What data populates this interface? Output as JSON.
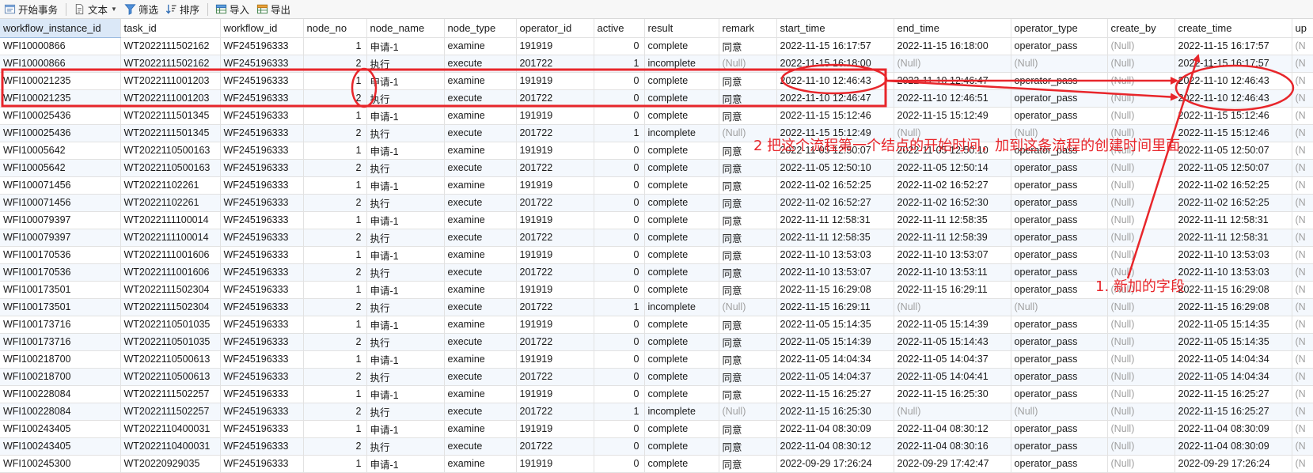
{
  "toolbar": {
    "begin_tx": "开始事务",
    "text": "文本",
    "filter": "筛选",
    "sort": "排序",
    "import": "导入",
    "export": "导出"
  },
  "columns": [
    "workflow_instance_id",
    "task_id",
    "workflow_id",
    "node_no",
    "node_name",
    "node_type",
    "operator_id",
    "active",
    "result",
    "remark",
    "start_time",
    "end_time",
    "operator_type",
    "create_by",
    "create_time",
    "up"
  ],
  "rows": [
    [
      "WFI10000866",
      "WT2022111502162",
      "WF245196333",
      "1",
      "申请-1",
      "examine",
      "191919",
      "0",
      "complete",
      "同意",
      "2022-11-15 16:17:57",
      "2022-11-15 16:18:00",
      "operator_pass",
      "(Null)",
      "2022-11-15 16:17:57",
      "(N"
    ],
    [
      "WFI10000866",
      "WT2022111502162",
      "WF245196333",
      "2",
      "执行",
      "execute",
      "201722",
      "1",
      "incomplete",
      "(Null)",
      "2022-11-15 16:18:00",
      "(Null)",
      "(Null)",
      "(Null)",
      "2022-11-15 16:17:57",
      "(N"
    ],
    [
      "WFI100021235",
      "WT2022111001203",
      "WF245196333",
      "1",
      "申请-1",
      "examine",
      "191919",
      "0",
      "complete",
      "同意",
      "2022-11-10 12:46:43",
      "2022-11-10 12:46:47",
      "operator_pass",
      "(Null)",
      "2022-11-10 12:46:43",
      "(N"
    ],
    [
      "WFI100021235",
      "WT2022111001203",
      "WF245196333",
      "2",
      "执行",
      "execute",
      "201722",
      "0",
      "complete",
      "同意",
      "2022-11-10 12:46:47",
      "2022-11-10 12:46:51",
      "operator_pass",
      "(Null)",
      "2022-11-10 12:46:43",
      "(N"
    ],
    [
      "WFI100025436",
      "WT2022111501345",
      "WF245196333",
      "1",
      "申请-1",
      "examine",
      "191919",
      "0",
      "complete",
      "同意",
      "2022-11-15 15:12:46",
      "2022-11-15 15:12:49",
      "operator_pass",
      "(Null)",
      "2022-11-15 15:12:46",
      "(N"
    ],
    [
      "WFI100025436",
      "WT2022111501345",
      "WF245196333",
      "2",
      "执行",
      "execute",
      "201722",
      "1",
      "incomplete",
      "(Null)",
      "2022-11-15 15:12:49",
      "(Null)",
      "(Null)",
      "(Null)",
      "2022-11-15 15:12:46",
      "(N"
    ],
    [
      "WFI10005642",
      "WT2022110500163",
      "WF245196333",
      "1",
      "申请-1",
      "examine",
      "191919",
      "0",
      "complete",
      "同意",
      "2022-11-05 12:50:07",
      "2022-11-05 12:50:10",
      "operator_pass",
      "(Null)",
      "2022-11-05 12:50:07",
      "(N"
    ],
    [
      "WFI10005642",
      "WT2022110500163",
      "WF245196333",
      "2",
      "执行",
      "execute",
      "201722",
      "0",
      "complete",
      "同意",
      "2022-11-05 12:50:10",
      "2022-11-05 12:50:14",
      "operator_pass",
      "(Null)",
      "2022-11-05 12:50:07",
      "(N"
    ],
    [
      "WFI100071456",
      "WT20221102261",
      "WF245196333",
      "1",
      "申请-1",
      "examine",
      "191919",
      "0",
      "complete",
      "同意",
      "2022-11-02 16:52:25",
      "2022-11-02 16:52:27",
      "operator_pass",
      "(Null)",
      "2022-11-02 16:52:25",
      "(N"
    ],
    [
      "WFI100071456",
      "WT20221102261",
      "WF245196333",
      "2",
      "执行",
      "execute",
      "201722",
      "0",
      "complete",
      "同意",
      "2022-11-02 16:52:27",
      "2022-11-02 16:52:30",
      "operator_pass",
      "(Null)",
      "2022-11-02 16:52:25",
      "(N"
    ],
    [
      "WFI100079397",
      "WT2022111100014",
      "WF245196333",
      "1",
      "申请-1",
      "examine",
      "191919",
      "0",
      "complete",
      "同意",
      "2022-11-11 12:58:31",
      "2022-11-11 12:58:35",
      "operator_pass",
      "(Null)",
      "2022-11-11 12:58:31",
      "(N"
    ],
    [
      "WFI100079397",
      "WT2022111100014",
      "WF245196333",
      "2",
      "执行",
      "execute",
      "201722",
      "0",
      "complete",
      "同意",
      "2022-11-11 12:58:35",
      "2022-11-11 12:58:39",
      "operator_pass",
      "(Null)",
      "2022-11-11 12:58:31",
      "(N"
    ],
    [
      "WFI100170536",
      "WT2022111001606",
      "WF245196333",
      "1",
      "申请-1",
      "examine",
      "191919",
      "0",
      "complete",
      "同意",
      "2022-11-10 13:53:03",
      "2022-11-10 13:53:07",
      "operator_pass",
      "(Null)",
      "2022-11-10 13:53:03",
      "(N"
    ],
    [
      "WFI100170536",
      "WT2022111001606",
      "WF245196333",
      "2",
      "执行",
      "execute",
      "201722",
      "0",
      "complete",
      "同意",
      "2022-11-10 13:53:07",
      "2022-11-10 13:53:11",
      "operator_pass",
      "(Null)",
      "2022-11-10 13:53:03",
      "(N"
    ],
    [
      "WFI100173501",
      "WT2022111502304",
      "WF245196333",
      "1",
      "申请-1",
      "examine",
      "191919",
      "0",
      "complete",
      "同意",
      "2022-11-15 16:29:08",
      "2022-11-15 16:29:11",
      "operator_pass",
      "(Null)",
      "2022-11-15 16:29:08",
      "(N"
    ],
    [
      "WFI100173501",
      "WT2022111502304",
      "WF245196333",
      "2",
      "执行",
      "execute",
      "201722",
      "1",
      "incomplete",
      "(Null)",
      "2022-11-15 16:29:11",
      "(Null)",
      "(Null)",
      "(Null)",
      "2022-11-15 16:29:08",
      "(N"
    ],
    [
      "WFI100173716",
      "WT2022110501035",
      "WF245196333",
      "1",
      "申请-1",
      "examine",
      "191919",
      "0",
      "complete",
      "同意",
      "2022-11-05 15:14:35",
      "2022-11-05 15:14:39",
      "operator_pass",
      "(Null)",
      "2022-11-05 15:14:35",
      "(N"
    ],
    [
      "WFI100173716",
      "WT2022110501035",
      "WF245196333",
      "2",
      "执行",
      "execute",
      "201722",
      "0",
      "complete",
      "同意",
      "2022-11-05 15:14:39",
      "2022-11-05 15:14:43",
      "operator_pass",
      "(Null)",
      "2022-11-05 15:14:35",
      "(N"
    ],
    [
      "WFI100218700",
      "WT2022110500613",
      "WF245196333",
      "1",
      "申请-1",
      "examine",
      "191919",
      "0",
      "complete",
      "同意",
      "2022-11-05 14:04:34",
      "2022-11-05 14:04:37",
      "operator_pass",
      "(Null)",
      "2022-11-05 14:04:34",
      "(N"
    ],
    [
      "WFI100218700",
      "WT2022110500613",
      "WF245196333",
      "2",
      "执行",
      "execute",
      "201722",
      "0",
      "complete",
      "同意",
      "2022-11-05 14:04:37",
      "2022-11-05 14:04:41",
      "operator_pass",
      "(Null)",
      "2022-11-05 14:04:34",
      "(N"
    ],
    [
      "WFI100228084",
      "WT2022111502257",
      "WF245196333",
      "1",
      "申请-1",
      "examine",
      "191919",
      "0",
      "complete",
      "同意",
      "2022-11-15 16:25:27",
      "2022-11-15 16:25:30",
      "operator_pass",
      "(Null)",
      "2022-11-15 16:25:27",
      "(N"
    ],
    [
      "WFI100228084",
      "WT2022111502257",
      "WF245196333",
      "2",
      "执行",
      "execute",
      "201722",
      "1",
      "incomplete",
      "(Null)",
      "2022-11-15 16:25:30",
      "(Null)",
      "(Null)",
      "(Null)",
      "2022-11-15 16:25:27",
      "(N"
    ],
    [
      "WFI100243405",
      "WT2022110400031",
      "WF245196333",
      "1",
      "申请-1",
      "examine",
      "191919",
      "0",
      "complete",
      "同意",
      "2022-11-04 08:30:09",
      "2022-11-04 08:30:12",
      "operator_pass",
      "(Null)",
      "2022-11-04 08:30:09",
      "(N"
    ],
    [
      "WFI100243405",
      "WT2022110400031",
      "WF245196333",
      "2",
      "执行",
      "execute",
      "201722",
      "0",
      "complete",
      "同意",
      "2022-11-04 08:30:12",
      "2022-11-04 08:30:16",
      "operator_pass",
      "(Null)",
      "2022-11-04 08:30:09",
      "(N"
    ],
    [
      "WFI100245300",
      "WT20220929035",
      "WF245196333",
      "1",
      "申请-1",
      "examine",
      "191919",
      "0",
      "complete",
      "同意",
      "2022-09-29 17:26:24",
      "2022-09-29 17:42:47",
      "operator_pass",
      "(Null)",
      "2022-09-29 17:26:24",
      "(N"
    ]
  ],
  "annotations": {
    "note_copy_start_time": "2 把这个流程第一个结点的开始时间，加到这条流程的创建时间里面",
    "note_new_field": "1. 新加的字段"
  },
  "colors": {
    "annotation_red": "#e8262b",
    "header_selected": "#dbe8f7",
    "row_alt": "#f4f8fd",
    "null_text": "#a0a0a0"
  }
}
